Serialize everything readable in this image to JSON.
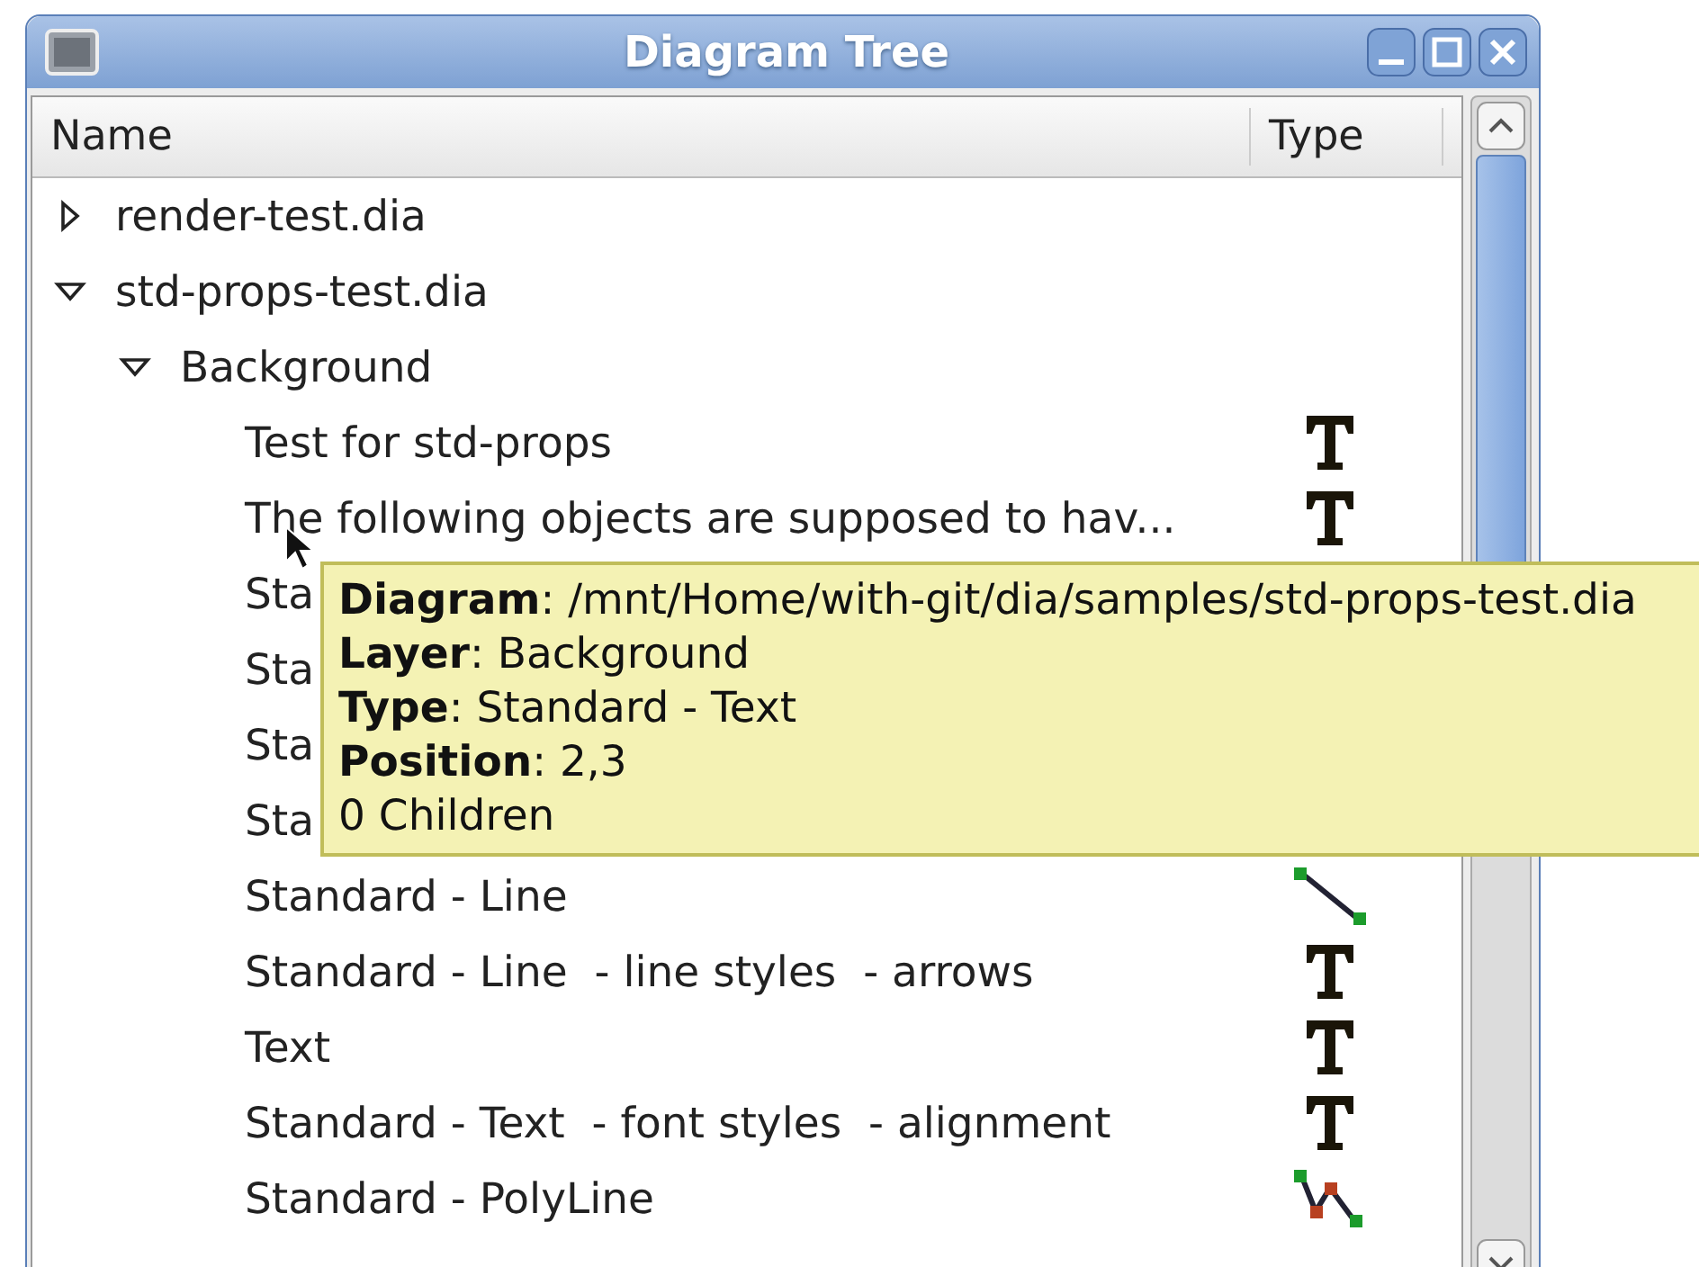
{
  "window": {
    "title": "Diagram Tree"
  },
  "columns": [
    "Name",
    "Type"
  ],
  "tree": [
    {
      "name": "render-test.dia",
      "expanded": false
    },
    {
      "name": "std-props-test.dia",
      "expanded": true,
      "children": [
        {
          "name": "Background",
          "expanded": true,
          "children": [
            {
              "name": "Test for std-props",
              "kind": "text"
            },
            {
              "name": "The following objects are supposed to hav...",
              "kind": "text"
            },
            {
              "name": "Sta"
            },
            {
              "name": "Sta"
            },
            {
              "name": "Sta"
            },
            {
              "name": "Sta"
            },
            {
              "name": "Standard - Line",
              "kind": "line"
            },
            {
              "name": "Standard - Line  - line styles  - arrows",
              "kind": "text"
            },
            {
              "name": "Text",
              "kind": "text"
            },
            {
              "name": "Standard - Text  - font styles  - alignment",
              "kind": "text"
            },
            {
              "name": "Standard - PolyLine",
              "kind": "polyline"
            }
          ]
        }
      ]
    }
  ],
  "tooltip": [
    "**Diagram**: /mnt/Home/with-git/dia/samples/std-props-test.dia",
    "**Layer**: Background",
    "**Type**: Standard - Text",
    "**Position**: 2,3",
    "0 Children"
  ]
}
